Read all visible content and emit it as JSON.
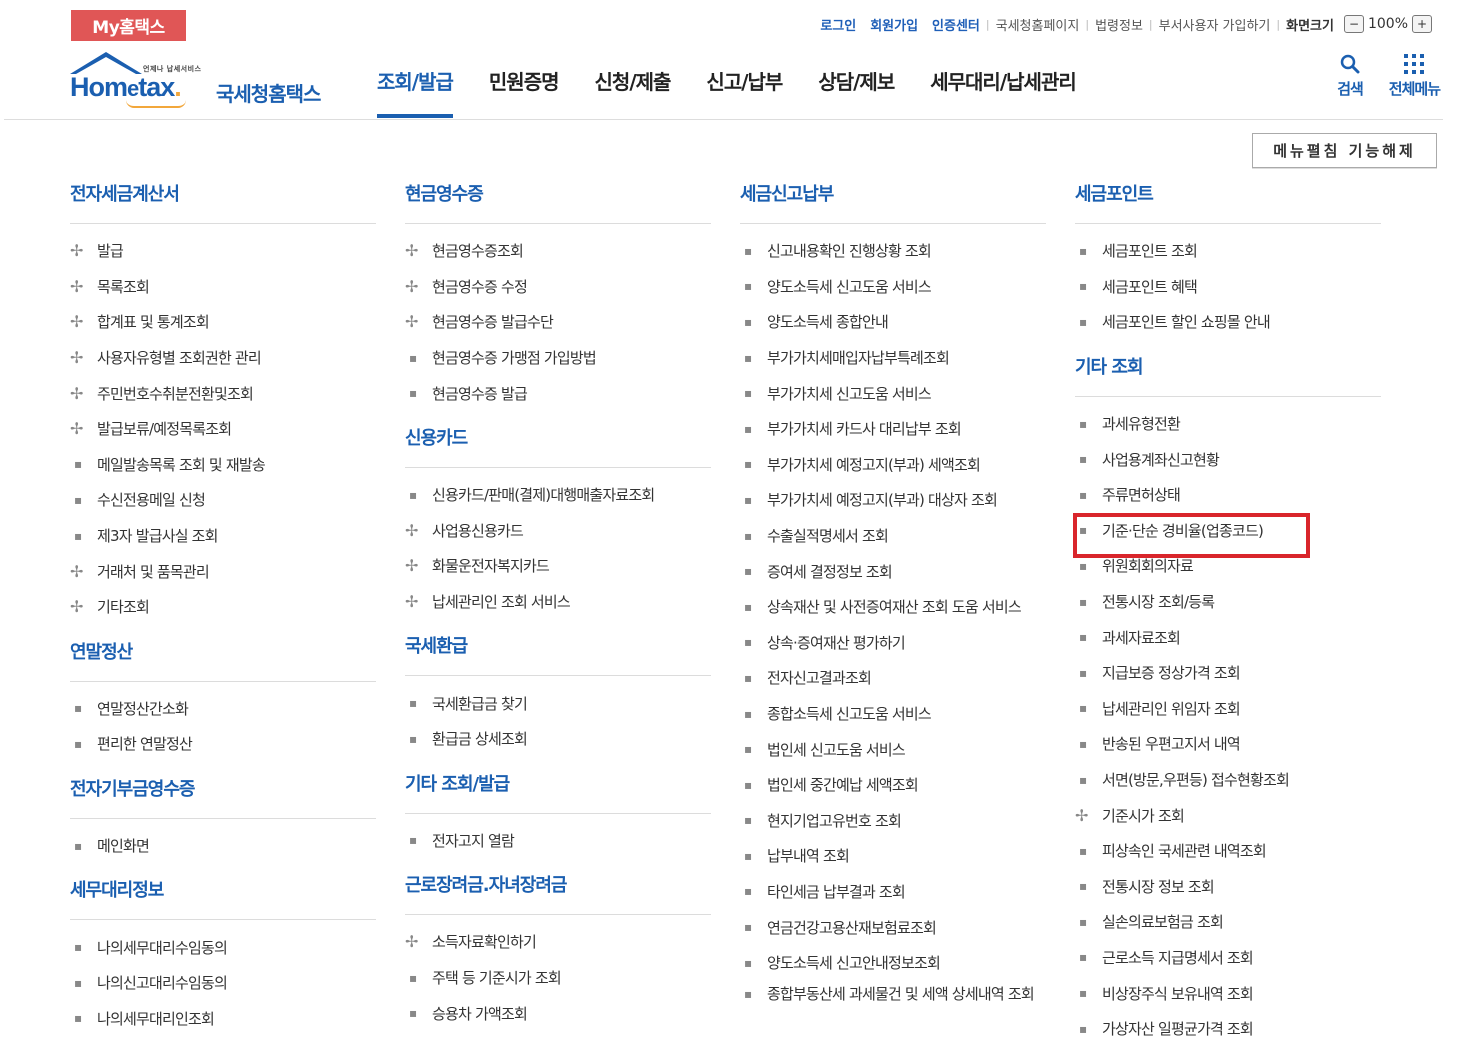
{
  "top": {
    "badge": "My홈택스",
    "links_blue": [
      "로그인",
      "회원가입",
      "인증센터"
    ],
    "links_plain": [
      "국세청홈페이지",
      "법령정보",
      "부서사용자 가입하기"
    ],
    "zoom_label": "화면크기",
    "zoom_minus": "−",
    "zoom_value": "100%",
    "zoom_plus": "+"
  },
  "logo": {
    "tiny": "언제나 납세서비스",
    "word_a": "Hom",
    "word_e": "e",
    "word_b": "tax",
    "word_dot": ".",
    "kor": "국세청홈택스"
  },
  "gnb": [
    "조회/발급",
    "민원증명",
    "신청/제출",
    "신고/납부",
    "상담/제보",
    "세무대리/납세관리"
  ],
  "tools": {
    "search": "검색",
    "all_menu": "전체메뉴"
  },
  "menu_toggle": "메뉴펼침 기능해제",
  "columns": [
    {
      "sections": [
        {
          "title": "전자세금계산서",
          "items": [
            {
              "t": "발급",
              "m": "plus"
            },
            {
              "t": "목록조회",
              "m": "plus"
            },
            {
              "t": "합계표 및 통계조회",
              "m": "plus"
            },
            {
              "t": "사용자유형별 조회권한 관리",
              "m": "plus"
            },
            {
              "t": "주민번호수취분전환및조회",
              "m": "plus"
            },
            {
              "t": "발급보류/예정목록조회",
              "m": "plus"
            },
            {
              "t": "메일발송목록 조회 및 재발송",
              "m": "dot"
            },
            {
              "t": "수신전용메일 신청",
              "m": "dot"
            },
            {
              "t": "제3자 발급사실 조회",
              "m": "dot"
            },
            {
              "t": "거래처 및 품목관리",
              "m": "plus"
            },
            {
              "t": "기타조회",
              "m": "plus"
            }
          ]
        },
        {
          "title": "연말정산",
          "items": [
            {
              "t": "연말정산간소화",
              "m": "dot"
            },
            {
              "t": "편리한 연말정산",
              "m": "dot"
            }
          ]
        },
        {
          "title": "전자기부금영수증",
          "items": [
            {
              "t": "메인화면",
              "m": "dot"
            }
          ]
        },
        {
          "title": "세무대리정보",
          "items": [
            {
              "t": "나의세무대리수임동의",
              "m": "dot"
            },
            {
              "t": "나의신고대리수임동의",
              "m": "dot"
            },
            {
              "t": "나의세무대리인조회",
              "m": "dot"
            }
          ]
        }
      ]
    },
    {
      "sections": [
        {
          "title": "현금영수증",
          "items": [
            {
              "t": "현금영수증조회",
              "m": "plus"
            },
            {
              "t": "현금영수증 수정",
              "m": "plus"
            },
            {
              "t": "현금영수증 발급수단",
              "m": "plus"
            },
            {
              "t": "현금영수증 가맹점 가입방법",
              "m": "dot"
            },
            {
              "t": "현금영수증 발급",
              "m": "dot"
            }
          ]
        },
        {
          "title": "신용카드",
          "items": [
            {
              "t": "신용카드/판매(결제)대행매출자료조회",
              "m": "dot"
            },
            {
              "t": "사업용신용카드",
              "m": "plus"
            },
            {
              "t": "화물운전자복지카드",
              "m": "plus"
            },
            {
              "t": "납세관리인 조회 서비스",
              "m": "plus"
            }
          ]
        },
        {
          "title": "국세환급",
          "items": [
            {
              "t": "국세환급금 찾기",
              "m": "dot"
            },
            {
              "t": "환급금 상세조회",
              "m": "dot"
            }
          ]
        },
        {
          "title": "기타 조회/발급",
          "items": [
            {
              "t": "전자고지 열람",
              "m": "dot"
            }
          ]
        },
        {
          "title": "근로장려금.자녀장려금",
          "items": [
            {
              "t": "소득자료확인하기",
              "m": "plus"
            },
            {
              "t": "주택 등 기준시가 조회",
              "m": "dot"
            },
            {
              "t": "승용차 가액조회",
              "m": "dot"
            }
          ]
        }
      ]
    },
    {
      "sections": [
        {
          "title": "세금신고납부",
          "items": [
            {
              "t": "신고내용확인 진행상황 조회",
              "m": "dot"
            },
            {
              "t": "양도소득세 신고도움 서비스",
              "m": "dot"
            },
            {
              "t": "양도소득세 종합안내",
              "m": "dot"
            },
            {
              "t": "부가가치세매입자납부특례조회",
              "m": "dot"
            },
            {
              "t": "부가가치세 신고도움 서비스",
              "m": "dot"
            },
            {
              "t": "부가가치세 카드사 대리납부 조회",
              "m": "dot"
            },
            {
              "t": "부가가치세 예정고지(부과) 세액조회",
              "m": "dot"
            },
            {
              "t": "부가가치세 예정고지(부과) 대상자 조회",
              "m": "dot"
            },
            {
              "t": "수출실적명세서 조회",
              "m": "dot"
            },
            {
              "t": "증여세 결정정보 조회",
              "m": "dot"
            },
            {
              "t": "상속재산 및 사전증여재산 조회 도움 서비스",
              "m": "dot"
            },
            {
              "t": "상속·증여재산 평가하기",
              "m": "dot"
            },
            {
              "t": "전자신고결과조회",
              "m": "dot"
            },
            {
              "t": "종합소득세 신고도움 서비스",
              "m": "dot"
            },
            {
              "t": "법인세 신고도움 서비스",
              "m": "dot"
            },
            {
              "t": "법인세 중간예납 세액조회",
              "m": "dot"
            },
            {
              "t": "현지기업고유번호 조회",
              "m": "dot"
            },
            {
              "t": "납부내역 조회",
              "m": "dot"
            },
            {
              "t": "타인세금 납부결과 조회",
              "m": "dot"
            },
            {
              "t": "연금건강고용산재보험료조회",
              "m": "dot"
            },
            {
              "t": "양도소득세 신고안내정보조회",
              "m": "dot"
            },
            {
              "t": "종합부동산세 과세물건 및 세액 상세내역 조회",
              "m": "dot",
              "two": true
            }
          ]
        }
      ]
    },
    {
      "sections": [
        {
          "title": "세금포인트",
          "items": [
            {
              "t": "세금포인트 조회",
              "m": "dot"
            },
            {
              "t": "세금포인트 혜택",
              "m": "dot"
            },
            {
              "t": "세금포인트 할인 쇼핑몰 안내",
              "m": "dot"
            }
          ]
        },
        {
          "title": "기타 조회",
          "items": [
            {
              "t": "과세유형전환",
              "m": "dot"
            },
            {
              "t": "사업용계좌신고현황",
              "m": "dot"
            },
            {
              "t": "주류면허상태",
              "m": "dot"
            },
            {
              "t": "기준·단순 경비율(업종코드)",
              "m": "dot",
              "hl": true
            },
            {
              "t": "위원회회의자료",
              "m": "dot"
            },
            {
              "t": "전통시장 조회/등록",
              "m": "dot"
            },
            {
              "t": "과세자료조회",
              "m": "dot"
            },
            {
              "t": "지급보증 정상가격 조회",
              "m": "dot"
            },
            {
              "t": "납세관리인 위임자 조회",
              "m": "dot"
            },
            {
              "t": "반송된 우편고지서 내역",
              "m": "dot"
            },
            {
              "t": "서면(방문,우편등) 접수현황조회",
              "m": "dot"
            },
            {
              "t": "기준시가 조회",
              "m": "plus"
            },
            {
              "t": "피상속인 국세관련 내역조회",
              "m": "dot"
            },
            {
              "t": "전통시장 정보 조회",
              "m": "dot"
            },
            {
              "t": "실손의료보험금 조회",
              "m": "dot"
            },
            {
              "t": "근로소득 지급명세서 조회",
              "m": "dot"
            },
            {
              "t": "비상장주식 보유내역 조회",
              "m": "dot"
            },
            {
              "t": "가상자산 일평균가격 조회",
              "m": "dot"
            }
          ]
        }
      ]
    }
  ]
}
